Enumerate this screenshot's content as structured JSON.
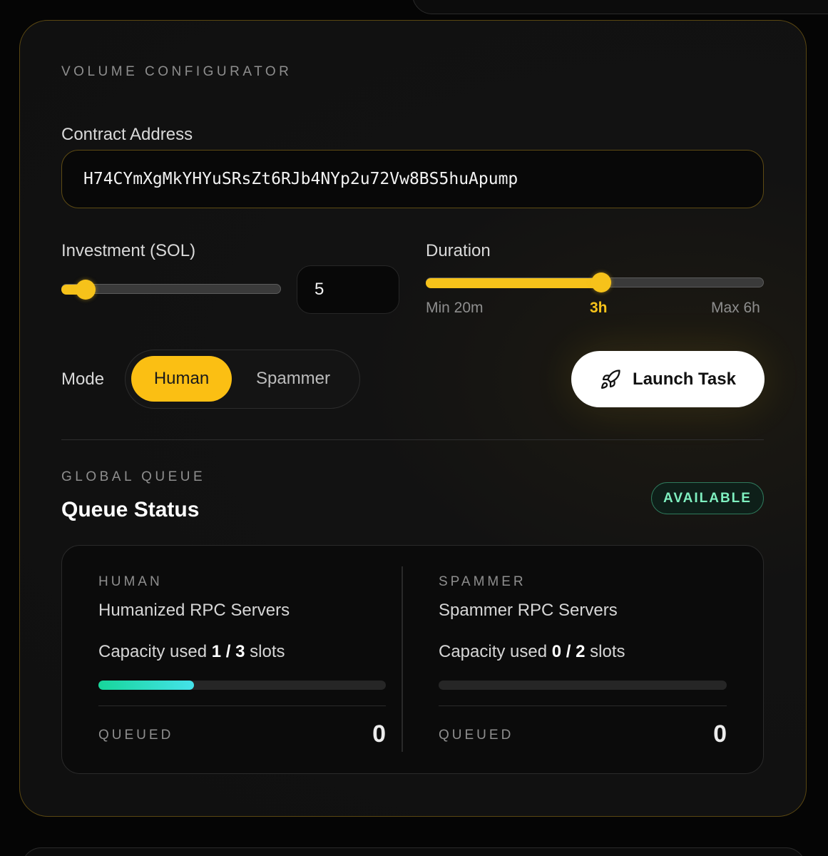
{
  "configurator": {
    "eyebrow": "VOLUME CONFIGURATOR",
    "contract_label": "Contract Address",
    "contract_value": "H74CYmXgMkYHYuSRsZt6RJb4NYp2u72Vw8BS5huApump",
    "investment_label": "Investment (SOL)",
    "investment_value": "5",
    "investment_slider_fraction": 0.11,
    "duration_label": "Duration",
    "duration_slider_fraction": 0.52,
    "duration_min": "Min 20m",
    "duration_current": "3h",
    "duration_max": "Max 6h",
    "mode_label": "Mode",
    "mode_options": [
      "Human",
      "Spammer"
    ],
    "mode_selected": "Human",
    "launch_label": "Launch Task"
  },
  "queue": {
    "eyebrow": "GLOBAL QUEUE",
    "title": "Queue Status",
    "status_badge": "AVAILABLE",
    "columns": [
      {
        "eyebrow": "HUMAN",
        "title": "Humanized RPC Servers",
        "capacity_prefix": "Capacity used",
        "capacity_used": "1",
        "capacity_sep": "/",
        "capacity_total": "3",
        "capacity_suffix": "slots",
        "capacity_fraction": 0.333,
        "queued_label": "QUEUED",
        "queued_value": "0"
      },
      {
        "eyebrow": "SPAMMER",
        "title": "Spammer RPC Servers",
        "capacity_prefix": "Capacity used",
        "capacity_used": "0",
        "capacity_sep": "/",
        "capacity_total": "2",
        "capacity_suffix": "slots",
        "capacity_fraction": 0,
        "queued_label": "QUEUED",
        "queued_value": "0"
      }
    ]
  },
  "colors": {
    "accent": "#f6c21a",
    "success": "#7ff0c0",
    "progress_start": "#17d69a",
    "progress_end": "#45e2ea"
  },
  "icons": {
    "launch": "rocket-icon"
  }
}
